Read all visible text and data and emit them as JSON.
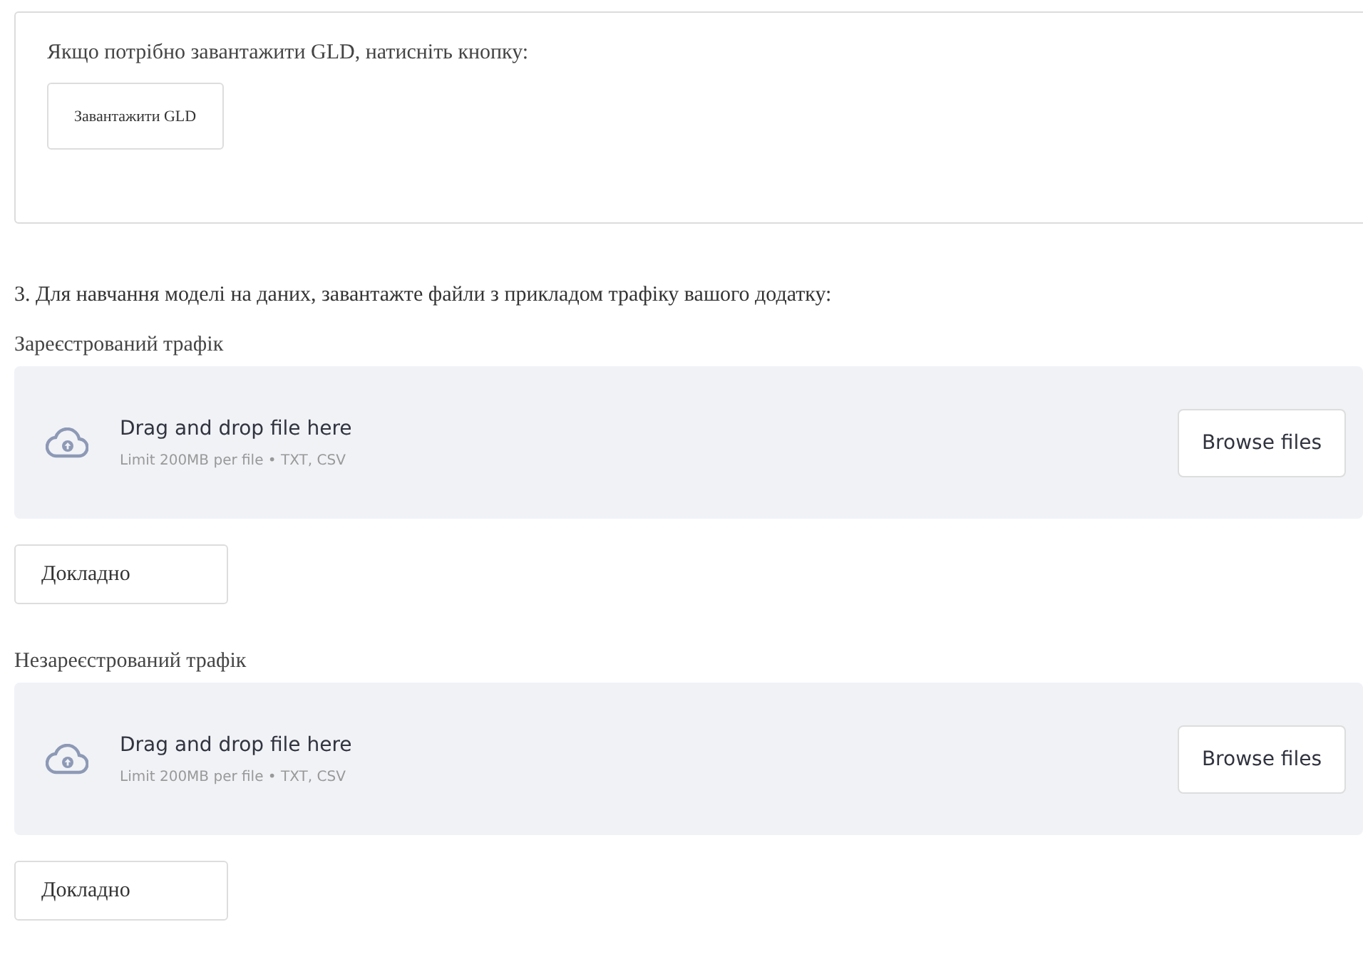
{
  "gld_box": {
    "text": "Якщо потрібно завантажити GLD, натисніть кнопку:",
    "button": "Завантажити GLD"
  },
  "instruction": "3. Для навчання моделі на даних, завантажте файли з прикладом трафіку вашого додатку:",
  "uploaders": [
    {
      "label": "Зареєстрований трафік",
      "drop_text": "Drag and drop file here",
      "limit": "Limit 200MB per file • TXT, CSV",
      "browse": "Browse files",
      "details": "Докладно"
    },
    {
      "label": "Незареєстрований трафік",
      "drop_text": "Drag and drop file here",
      "limit": "Limit 200MB per file • TXT, CSV",
      "browse": "Browse files",
      "details": "Докладно"
    }
  ]
}
